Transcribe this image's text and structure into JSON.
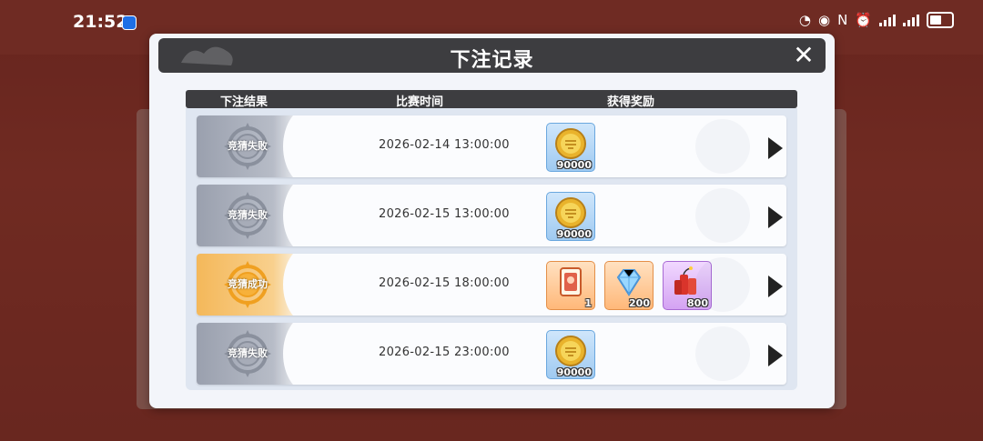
{
  "status_bar": {
    "time": "21:52",
    "icons": [
      "speed-icon",
      "eye-icon",
      "nfc-icon",
      "alarm-icon",
      "signal-icon",
      "signal-icon",
      "battery-icon"
    ]
  },
  "dialog": {
    "title": "下注记录",
    "close_icon": "close-icon"
  },
  "table": {
    "headers": [
      "下注结果",
      "比赛时间",
      "获得奖励"
    ],
    "rows": [
      {
        "result": "竞猜失败",
        "status": "lose",
        "time": "2026-02-14  13:00:00",
        "rewards": [
          {
            "icon": "gold-coin-icon",
            "qty": "90000",
            "frame": "blue"
          }
        ]
      },
      {
        "result": "竞猜失败",
        "status": "lose",
        "time": "2026-02-15  13:00:00",
        "rewards": [
          {
            "icon": "gold-coin-icon",
            "qty": "90000",
            "frame": "blue"
          }
        ]
      },
      {
        "result": "竞猜成功",
        "status": "win",
        "time": "2026-02-15  18:00:00",
        "rewards": [
          {
            "icon": "card-icon",
            "qty": "1",
            "frame": "orange"
          },
          {
            "icon": "diamond-icon",
            "qty": "200",
            "frame": "orange"
          },
          {
            "icon": "firecracker-icon",
            "qty": "800",
            "frame": "purple"
          }
        ]
      },
      {
        "result": "竞猜失败",
        "status": "lose",
        "time": "2026-02-15  23:00:00",
        "rewards": [
          {
            "icon": "gold-coin-icon",
            "qty": "90000",
            "frame": "blue"
          }
        ]
      }
    ]
  },
  "colors": {
    "header_bg": "#3d3d40",
    "lose_badge": "#9aa0ae",
    "win_badge": "#f4b85a",
    "panel_bg": "#f3f5fa"
  }
}
